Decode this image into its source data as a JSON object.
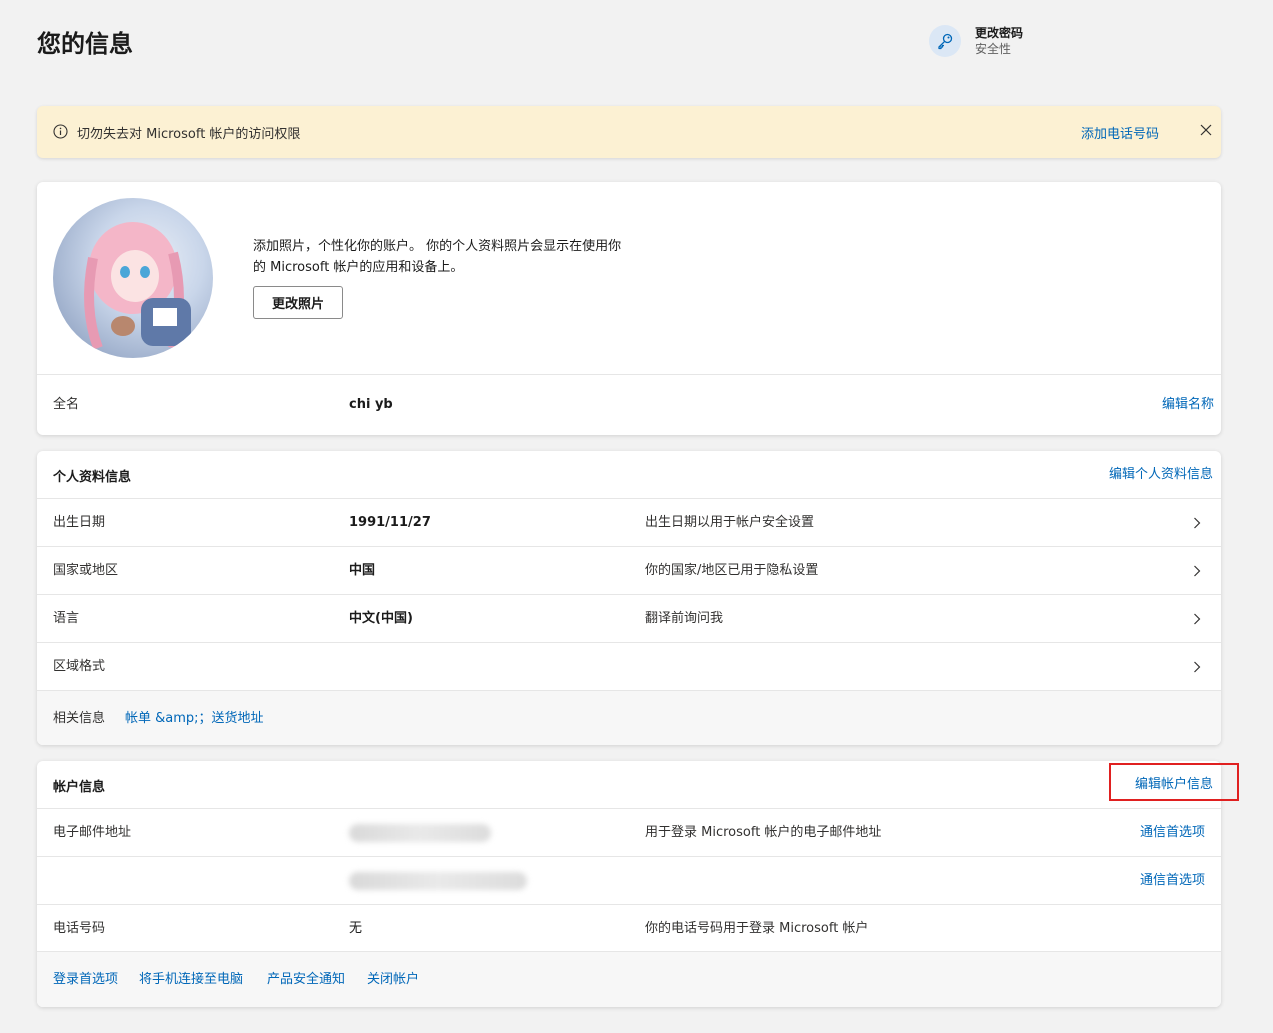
{
  "header": {
    "title": "您的信息",
    "password": {
      "title": "更改密码",
      "subtitle": "安全性"
    }
  },
  "banner": {
    "message": "切勿失去对 Microsoft 帐户的访问权限",
    "action": "添加电话号码"
  },
  "photo_card": {
    "description": "添加照片，个性化你的账户。 你的个人资料照片会显示在使用你的 Microsoft 帐户的应用和设备上。",
    "change_photo": "更改照片",
    "fullname_label": "全名",
    "fullname_value": "chi yb",
    "edit_name": "编辑名称"
  },
  "profile": {
    "title": "个人资料信息",
    "edit": "编辑个人资料信息",
    "rows": [
      {
        "label": "出生日期",
        "value": "1991/11/27",
        "desc": "出生日期以用于帐户安全设置"
      },
      {
        "label": "国家或地区",
        "value": "中国",
        "desc": "你的国家/地区已用于隐私设置"
      },
      {
        "label": "语言",
        "value": "中文(中国)",
        "desc": "翻译前询问我"
      },
      {
        "label": "区域格式",
        "value": "",
        "desc": ""
      }
    ],
    "related_label": "相关信息",
    "related_link": "帐单 &amp;；送货地址"
  },
  "account": {
    "title": "帐户信息",
    "edit": "编辑帐户信息",
    "email_label": "电子邮件地址",
    "email_desc": "用于登录 Microsoft 帐户的电子邮件地址",
    "comm_pref_1": "通信首选项",
    "comm_pref_2": "通信首选项",
    "phone_label": "电话号码",
    "phone_value": "无",
    "phone_desc": "你的电话号码用于登录 Microsoft 帐户",
    "links": [
      "登录首选项",
      "将手机连接至电脑",
      "产品安全通知",
      "关闭帐户"
    ]
  },
  "colors": {
    "accent": "#0067b8",
    "banner_bg": "#fcf1d3",
    "highlight": "#e02020"
  }
}
